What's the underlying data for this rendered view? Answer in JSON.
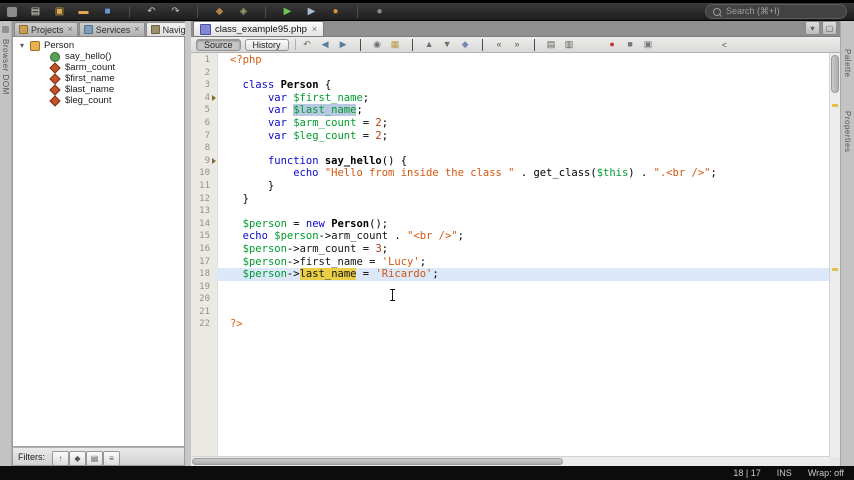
{
  "colors": {
    "kw": "#0a0ac8",
    "var": "#009c2e",
    "str": "#d4560f",
    "num": "#b23a0f",
    "tag": "#d95f0f",
    "prop": "#151515",
    "line_hl": "#dbe8fa",
    "occ_yellow": "#e9cf45",
    "occ_blue": "#b9c8e2",
    "gutter_bg": "#ebe9e3",
    "gutter_fg": "#969085"
  },
  "glyphs": {
    "close": "×",
    "expander": "▾"
  },
  "toolbar": {
    "search_placeholder": "Search (⌘+I)",
    "icons": [
      {
        "name": "new-file",
        "glyph": "▤",
        "color": "#dcdcd2"
      },
      {
        "name": "new-project",
        "glyph": "▣",
        "color": "#ddaa4f"
      },
      {
        "name": "open-project",
        "glyph": "▬",
        "color": "#ddaa4f"
      },
      {
        "name": "save-all",
        "glyph": "■",
        "color": "#6b97d8"
      },
      {
        "sep": true
      },
      {
        "name": "undo",
        "glyph": "↶",
        "color": "#c0c0c0"
      },
      {
        "name": "redo",
        "glyph": "↷",
        "color": "#c0c0c0"
      },
      {
        "sep": true
      },
      {
        "name": "build-project",
        "glyph": "◆",
        "color": "#b08448"
      },
      {
        "name": "clean-build-project",
        "glyph": "◈",
        "color": "#9aa86a"
      },
      {
        "sep": true
      },
      {
        "name": "run-project",
        "glyph": "▶",
        "color": "#6fc556"
      },
      {
        "name": "debug-project",
        "glyph": "▶",
        "color": "#aabdd2"
      },
      {
        "name": "profile-project",
        "glyph": "●",
        "color": "#d98f3e"
      },
      {
        "sep": true
      },
      {
        "name": "team-server",
        "glyph": "●",
        "color": "#8f8f8f"
      }
    ]
  },
  "left_strip": {
    "label": "Browser DOM"
  },
  "right_strip": {
    "labels": [
      "Palette",
      "Properties"
    ]
  },
  "left_panel": {
    "tabs": [
      {
        "label": "Projects"
      },
      {
        "label": "Services"
      },
      {
        "label": "Naviga..."
      }
    ],
    "navigator": {
      "root_label": "Person",
      "items": [
        {
          "label": "say_hello()",
          "icon": "method"
        },
        {
          "label": "$arm_count",
          "icon": "field"
        },
        {
          "label": "$first_name",
          "icon": "field"
        },
        {
          "label": "$last_name",
          "icon": "field"
        },
        {
          "label": "$leg_count",
          "icon": "field"
        }
      ],
      "filters_label": "Filters:",
      "filter_buttons": [
        {
          "name": "filter-show-inherited",
          "glyph": "↑"
        },
        {
          "name": "filter-show-fields",
          "glyph": "◆"
        },
        {
          "name": "filter-show-static",
          "glyph": "▤"
        },
        {
          "name": "filter-sort-alpha",
          "glyph": "≡"
        }
      ]
    }
  },
  "editor": {
    "tab_label": "class_example95.php",
    "window_buttons": [
      {
        "name": "tab-list",
        "glyph": "▾"
      },
      {
        "name": "maximize-window",
        "glyph": "▢"
      }
    ],
    "toolbar": {
      "source_label": "Source",
      "history_label": "History",
      "overflow": "<",
      "icons": [
        {
          "name": "last-edit-position",
          "glyph": "↶",
          "color": "#6f6f6f"
        },
        {
          "name": "back",
          "glyph": "◀",
          "color": "#55809c"
        },
        {
          "name": "forward",
          "glyph": "▶",
          "color": "#55809c"
        },
        {
          "sep": true
        },
        {
          "name": "find-selection",
          "glyph": "◉",
          "color": "#6f6f6f"
        },
        {
          "name": "highlight-search",
          "glyph": "▦",
          "color": "#b89a3e"
        },
        {
          "sep": true
        },
        {
          "name": "previous-bookmark",
          "glyph": "▲",
          "color": "#6f6f6f"
        },
        {
          "name": "next-bookmark",
          "glyph": "▼",
          "color": "#6f6f6f"
        },
        {
          "name": "toggle-bookmark",
          "glyph": "◆",
          "color": "#7188b5"
        },
        {
          "sep": true
        },
        {
          "name": "shift-line-left",
          "glyph": "«",
          "color": "#5a5a5a"
        },
        {
          "name": "shift-line-right",
          "glyph": "»",
          "color": "#5a5a5a"
        },
        {
          "sep": true
        },
        {
          "name": "comment",
          "glyph": "▤",
          "color": "#5a5a5a"
        },
        {
          "name": "uncomment",
          "glyph": "▥",
          "color": "#5a5a5a"
        }
      ],
      "right_icons": [
        {
          "name": "start-macro-recording",
          "glyph": "●",
          "color": "#c53030"
        },
        {
          "name": "stop-macro-recording",
          "glyph": "■",
          "color": "#777777"
        },
        {
          "name": "insert-code",
          "glyph": "▣",
          "color": "#777777"
        }
      ]
    },
    "lines": [
      {
        "n": 1,
        "t": [
          [
            "tag",
            "<?php"
          ]
        ]
      },
      {
        "n": 2,
        "t": []
      },
      {
        "n": 3,
        "t": [
          [
            "plain",
            "  "
          ],
          [
            "kw",
            "class"
          ],
          [
            "plain",
            " "
          ],
          [
            "cls",
            "Person"
          ],
          [
            "plain",
            " {"
          ]
        ]
      },
      {
        "n": 4,
        "marker": true,
        "t": [
          [
            "plain",
            "      "
          ],
          [
            "kw",
            "var"
          ],
          [
            "plain",
            " "
          ],
          [
            "var",
            "$first_name"
          ],
          [
            "plain",
            ";"
          ]
        ]
      },
      {
        "n": 5,
        "t": [
          [
            "plain",
            "      "
          ],
          [
            "kw",
            "var"
          ],
          [
            "plain",
            " "
          ],
          [
            "var hlb",
            "$last_name"
          ],
          [
            "plain",
            ";"
          ]
        ]
      },
      {
        "n": 6,
        "t": [
          [
            "plain",
            "      "
          ],
          [
            "kw",
            "var"
          ],
          [
            "plain",
            " "
          ],
          [
            "var",
            "$arm_count"
          ],
          [
            "plain",
            " = "
          ],
          [
            "num",
            "2"
          ],
          [
            "plain",
            ";"
          ]
        ]
      },
      {
        "n": 7,
        "t": [
          [
            "plain",
            "      "
          ],
          [
            "kw",
            "var"
          ],
          [
            "plain",
            " "
          ],
          [
            "var",
            "$leg_count"
          ],
          [
            "plain",
            " = "
          ],
          [
            "num",
            "2"
          ],
          [
            "plain",
            ";"
          ]
        ]
      },
      {
        "n": 8,
        "t": []
      },
      {
        "n": 9,
        "marker": true,
        "t": [
          [
            "plain",
            "      "
          ],
          [
            "kw",
            "function"
          ],
          [
            "plain",
            " "
          ],
          [
            "fn",
            "say_hello"
          ],
          [
            "plain",
            "() {"
          ]
        ]
      },
      {
        "n": 10,
        "t": [
          [
            "plain",
            "          "
          ],
          [
            "kw",
            "echo"
          ],
          [
            "plain",
            " "
          ],
          [
            "str",
            "\"Hello from inside the class \""
          ],
          [
            "plain",
            " . get_class("
          ],
          [
            "var",
            "$this"
          ],
          [
            "plain",
            ") . "
          ],
          [
            "str",
            "\".<br />\""
          ],
          [
            "plain",
            ";"
          ]
        ]
      },
      {
        "n": 11,
        "t": [
          [
            "plain",
            "      }"
          ]
        ]
      },
      {
        "n": 12,
        "t": [
          [
            "plain",
            "  }"
          ]
        ]
      },
      {
        "n": 13,
        "t": []
      },
      {
        "n": 14,
        "t": [
          [
            "plain",
            "  "
          ],
          [
            "var",
            "$person"
          ],
          [
            "plain",
            " = "
          ],
          [
            "kw",
            "new"
          ],
          [
            "plain",
            " "
          ],
          [
            "cls",
            "Person"
          ],
          [
            "plain",
            "();"
          ]
        ]
      },
      {
        "n": 15,
        "t": [
          [
            "plain",
            "  "
          ],
          [
            "kw",
            "echo"
          ],
          [
            "plain",
            " "
          ],
          [
            "var",
            "$person"
          ],
          [
            "plain",
            "->"
          ],
          [
            "prop",
            "arm_count"
          ],
          [
            "plain",
            " . "
          ],
          [
            "str",
            "\"<br />\""
          ],
          [
            "plain",
            ";"
          ]
        ]
      },
      {
        "n": 16,
        "t": [
          [
            "plain",
            "  "
          ],
          [
            "var",
            "$person"
          ],
          [
            "plain",
            "->"
          ],
          [
            "prop",
            "arm_count"
          ],
          [
            "plain",
            " = "
          ],
          [
            "num",
            "3"
          ],
          [
            "plain",
            ";"
          ]
        ]
      },
      {
        "n": 17,
        "t": [
          [
            "plain",
            "  "
          ],
          [
            "var",
            "$person"
          ],
          [
            "plain",
            "->"
          ],
          [
            "prop",
            "first_name"
          ],
          [
            "plain",
            " = "
          ],
          [
            "str",
            "'Lucy'"
          ],
          [
            "plain",
            ";"
          ]
        ]
      },
      {
        "n": 18,
        "hl": true,
        "t": [
          [
            "plain",
            "  "
          ],
          [
            "var",
            "$person"
          ],
          [
            "plain",
            "->"
          ],
          [
            "prop hly",
            "last_"
          ],
          [
            "caret",
            ""
          ],
          [
            "prop hly",
            "name"
          ],
          [
            "plain",
            " = "
          ],
          [
            "str",
            "'Ricardo'"
          ],
          [
            "plain",
            ";"
          ]
        ]
      },
      {
        "n": 19,
        "t": []
      },
      {
        "n": 20,
        "t": []
      },
      {
        "n": 21,
        "t": []
      },
      {
        "n": 22,
        "t": [
          [
            "tag",
            "?>"
          ]
        ]
      }
    ]
  },
  "status_bar": {
    "caret_position": "18 | 17",
    "insert_mode": "INS",
    "wrap": "Wrap: off"
  }
}
